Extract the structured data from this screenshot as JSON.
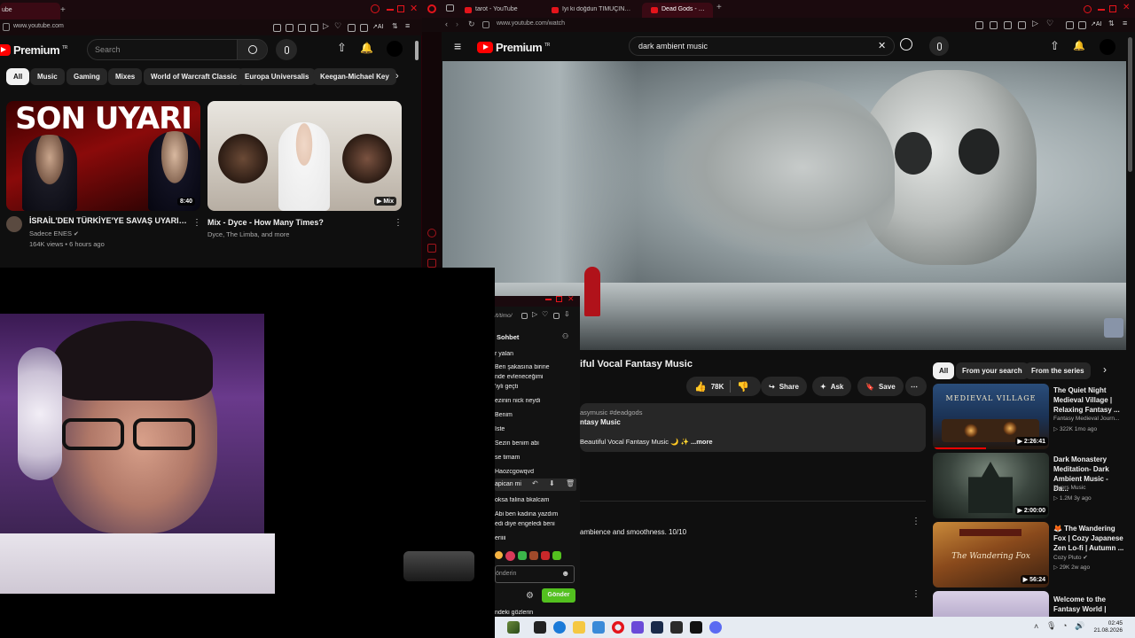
{
  "left_browser": {
    "tab_title": "ube",
    "url": "www.youtube.com",
    "logo_text": "Premium",
    "logo_badge": "TR",
    "search_placeholder": "Search",
    "chips": [
      "All",
      "Music",
      "Gaming",
      "Mixes",
      "World of Warcraft Classic",
      "Europa Universalis",
      "Keegan-Michael Key"
    ],
    "videos": [
      {
        "thumb_text": "SON UYARI",
        "duration": "8:40",
        "title": "İSRAİL'DEN TÜRKİYE'YE SAVAŞ UYARISI!",
        "channel": "Sadece ENES",
        "meta": "164K views • 6 hours ago"
      },
      {
        "thumb_badge": "Mix",
        "title": "Mix - Dyce - How Many Times?",
        "channel": "Dyce, The Limba, and more"
      }
    ]
  },
  "right_browser": {
    "tabs": [
      "tarot - YouTube",
      "İyi ki doğdun TIMUÇIN - Yo",
      "Dead Gods - Haunting"
    ],
    "url": "www.youtube.com/watch",
    "logo_text": "Premium",
    "logo_badge": "TR",
    "search_value": "dark ambient music",
    "video_title": "iful Vocal Fantasy Music",
    "likes": "78K",
    "share_label": "Share",
    "ask_label": "Ask",
    "save_label": "Save",
    "desc_tags": "asymusic #deadgods",
    "desc_line2": "ntasy Music",
    "desc_line3": "Beautiful Vocal Fantasy Music 🌙 ✨",
    "desc_more": "...more",
    "comment_text": "ambience and smoothness. 10/10",
    "rec_chips": [
      "All",
      "From your search",
      "From the series"
    ],
    "recommendations": [
      {
        "title": "The Quiet Night Medieval Village | Relaxing Fantasy ...",
        "channel": "Fantasy Medieval Journ...",
        "meta": "322K  1mo ago",
        "duration": "2:26:41",
        "thumb_text": "MEDIEVAL VILLAGE"
      },
      {
        "title": "Dark Monastery Meditation- Dark Ambient Music - Da...",
        "channel": "Myers Music",
        "meta": "1.2M  3y ago",
        "duration": "2:00:00"
      },
      {
        "title": "🦊 The Wandering Fox | Cozy Japanese Zen Lo-fi | Autumn ...",
        "channel": "Cozy Pluto",
        "meta": "29K  2w ago",
        "duration": "56:24",
        "thumb_text": "The Wandering Fox"
      },
      {
        "title": "Welcome to the Fantasy World |",
        "channel": "",
        "meta": "",
        "duration": ""
      }
    ]
  },
  "chat": {
    "header_url": "/t/timo/",
    "title": "Sohbet",
    "messages": [
      "r yalan",
      "Ben şakasına birine",
      "nde evleneceğimi",
      "'iyli geçti",
      "ezinin nick neydi",
      "Benim",
      "Iste",
      "Sezin benim abi",
      "se timam",
      "Haozcgowqvd",
      "apican mi",
      "oksa falina bkalcam",
      "Abi ben kadına yazdım",
      "edi diye engeledi beni",
      "eriiii"
    ],
    "input_placeholder": "önderin",
    "send_label": "Gönder",
    "footer_text": "ndeki gözlerin"
  },
  "taskbar": {
    "time": "02:45",
    "date": "21.08.2026"
  },
  "colors": {
    "yt_red": "#ff0000",
    "opera_red": "#e4141b",
    "bg": "#0f0f0f",
    "chip_bg": "#272727",
    "send_green": "#53c11f"
  }
}
